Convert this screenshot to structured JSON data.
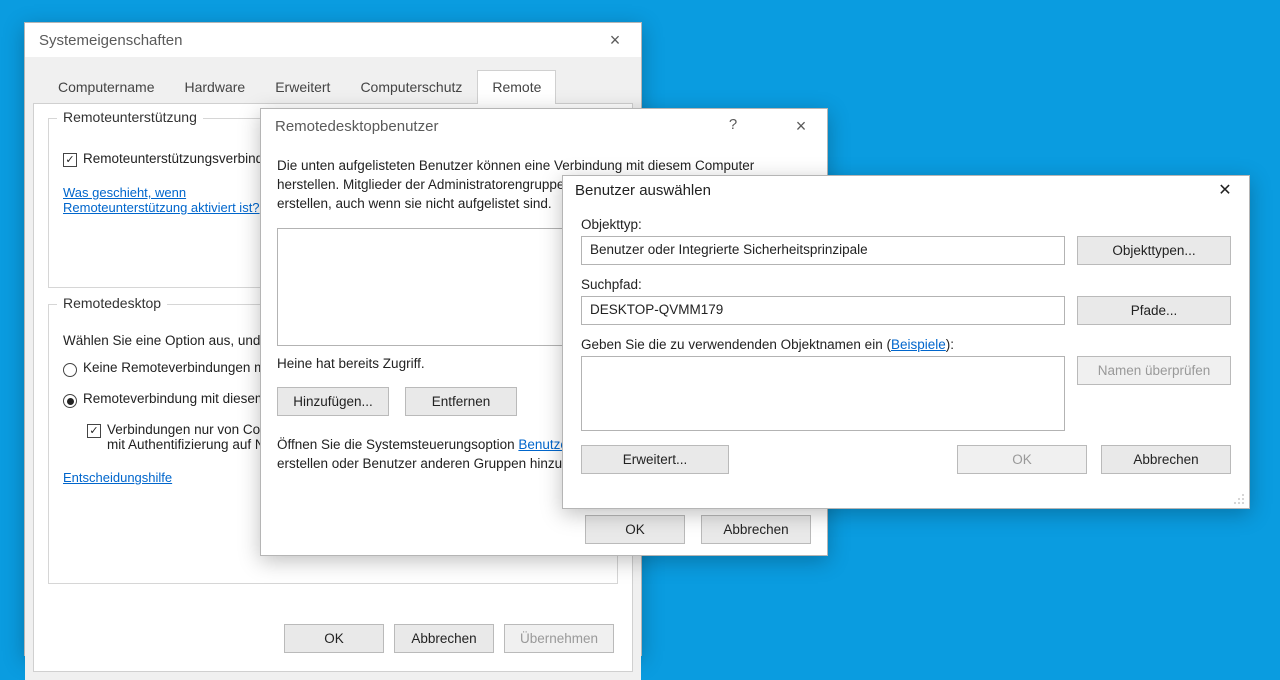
{
  "d1": {
    "title": "Systemeigenschaften",
    "tabs": [
      "Computername",
      "Hardware",
      "Erweitert",
      "Computerschutz",
      "Remote"
    ],
    "group1": {
      "title": "Remoteunterstützung",
      "checkbox_label": "Remoteunterstützungsverbindungen mit diesem Computer zulassen",
      "link": "Was geschieht, wenn Remoteunterstützung aktiviert ist?"
    },
    "group2": {
      "title": "Remotedesktop",
      "intro": "Wählen Sie eine Option aus, und geben Sie an, wer eine Verbindung herstellen darf.",
      "radio1": "Keine Remoteverbindungen mit diesem Computer zulassen",
      "radio2": "Remoteverbindung mit diesem Computer zulassen",
      "sub_checkbox": "Verbindungen nur von Computern zulassen, auf denen Remotedesktop mit Authentifizierung auf Netzwerkebene ausgeführt wird (empfohlen)",
      "link": "Entscheidungshilfe"
    },
    "buttons": {
      "ok": "OK",
      "cancel": "Abbrechen",
      "apply": "Übernehmen"
    }
  },
  "d2": {
    "title": "Remotedesktopbenutzer",
    "intro": "Die unten aufgelisteten Benutzer können eine Verbindung mit diesem Computer herstellen. Mitglieder der Administratorengruppe können eine Remoteverbindung erstellen, auch wenn sie nicht aufgelistet sind.",
    "user_has_access": "Heine hat bereits Zugriff.",
    "add": "Hinzufügen...",
    "remove": "Entfernen",
    "open_text_before": "Öffnen Sie die Systemsteuerungsoption ",
    "open_link": "Benutzerkonten",
    "open_text_after": ", um neue Benutzerkonten zu erstellen oder Benutzer anderen Gruppen hinzuzufügen.",
    "buttons": {
      "ok": "OK",
      "cancel": "Abbrechen"
    }
  },
  "d3": {
    "title": "Benutzer auswählen",
    "objtype_label": "Objekttyp:",
    "objtype_value": "Benutzer oder Integrierte Sicherheitsprinzipale",
    "objtypes_btn": "Objekttypen...",
    "path_label": "Suchpfad:",
    "path_value": "DESKTOP-QVMM179",
    "paths_btn": "Pfade...",
    "names_label_before": "Geben Sie die zu verwendenden Objektnamen ein (",
    "names_link": "Beispiele",
    "names_label_after": "):",
    "check_btn": "Namen überprüfen",
    "advanced": "Erweitert...",
    "buttons": {
      "ok": "OK",
      "cancel": "Abbrechen"
    }
  }
}
